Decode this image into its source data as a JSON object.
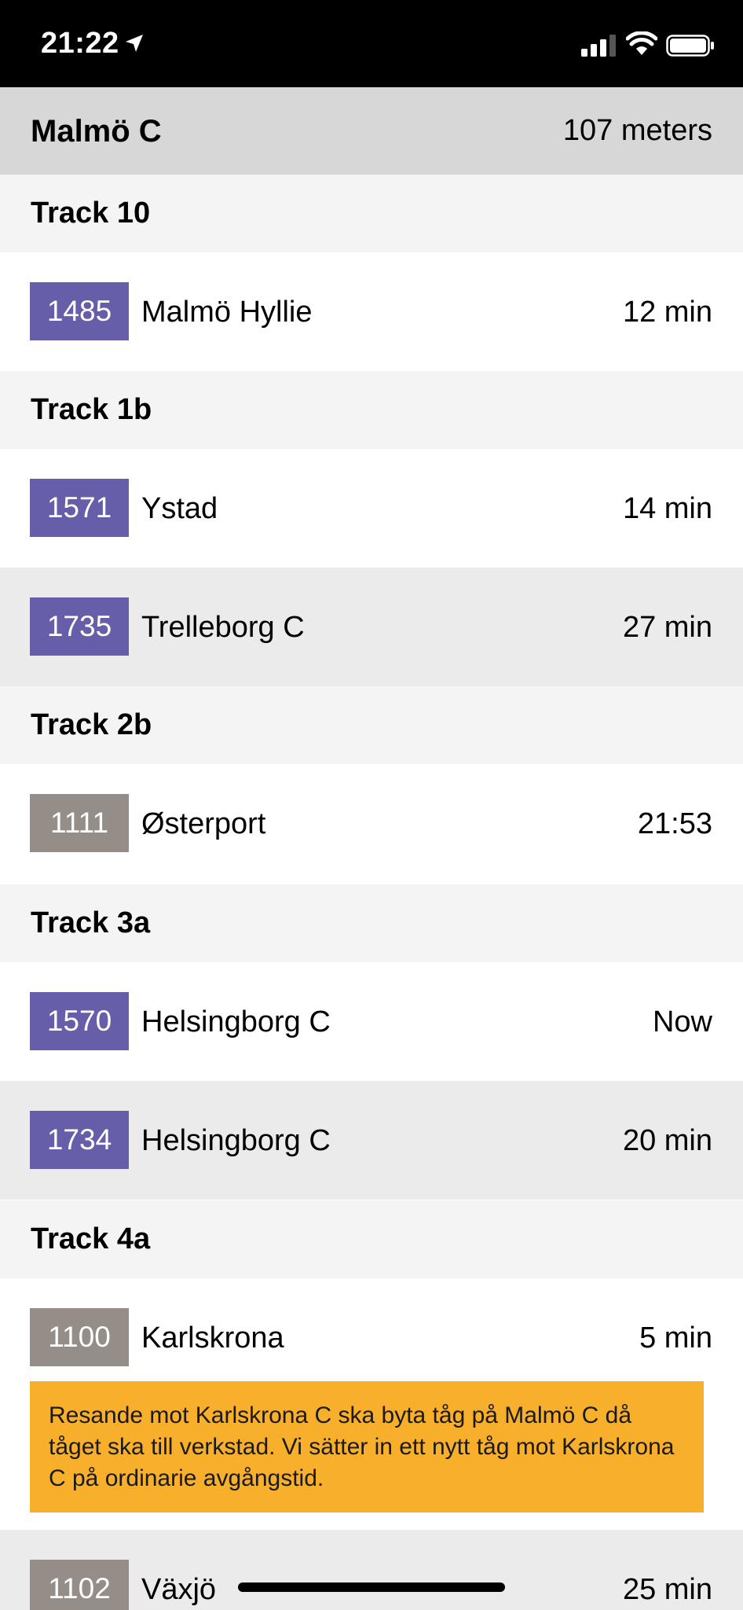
{
  "status_bar": {
    "time": "21:22"
  },
  "station": {
    "name": "Malmö C",
    "distance": "107 meters"
  },
  "tracks": [
    {
      "title": "Track 10",
      "departures": [
        {
          "train": "1485",
          "destination": "Malmö Hyllie",
          "time": "12 min"
        }
      ]
    },
    {
      "title": "Track 1b",
      "departures": [
        {
          "train": "1571",
          "destination": "Ystad",
          "time": "14 min"
        },
        {
          "train": "1735",
          "destination": "Trelleborg C",
          "time": "27 min"
        }
      ]
    },
    {
      "title": "Track 2b",
      "departures": [
        {
          "train": "1111",
          "destination": "Østerport",
          "time": "21:53"
        }
      ]
    },
    {
      "title": "Track 3a",
      "departures": [
        {
          "train": "1570",
          "destination": "Helsingborg C",
          "time": "Now"
        },
        {
          "train": "1734",
          "destination": "Helsingborg C",
          "time": "20 min"
        }
      ]
    },
    {
      "title": "Track 4a",
      "departures": [
        {
          "train": "1100",
          "destination": "Karlskrona",
          "time": "5 min",
          "notice": "Resande mot Karlskrona C ska byta tåg på Malmö C då tåget ska till verkstad. Vi sätter in ett nytt tåg mot Karlskrona C på ordinarie avgångstid."
        },
        {
          "train": "1102",
          "destination": "Växjö",
          "time": "25 min"
        }
      ]
    }
  ],
  "colors": {
    "regional": "#665ea9",
    "oresund": "#958d88",
    "notice": "#f8af2b"
  }
}
